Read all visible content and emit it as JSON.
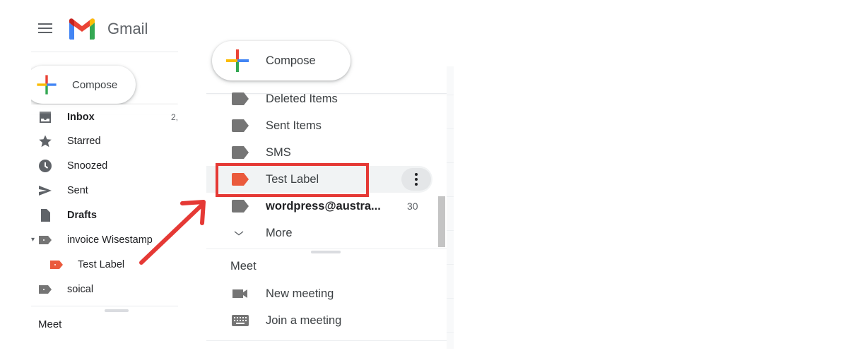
{
  "app": {
    "name": "Gmail"
  },
  "colors": {
    "accent_red": "#e53935",
    "label_gray": "#757575",
    "label_test": "#ea5a3c",
    "hover_bg": "#f1f3f4"
  },
  "left_panel": {
    "compose_label": "Compose",
    "items": [
      {
        "icon": "inbox-icon",
        "label": "Inbox",
        "count": "2,",
        "bold": true
      },
      {
        "icon": "star-icon",
        "label": "Starred"
      },
      {
        "icon": "clock-icon",
        "label": "Snoozed"
      },
      {
        "icon": "send-icon",
        "label": "Sent"
      },
      {
        "icon": "draft-icon",
        "label": "Drafts",
        "bold": true
      },
      {
        "icon": "label-icon",
        "label": "invoice Wisestamp",
        "expander": "▾"
      },
      {
        "icon": "label-icon",
        "label": "Test Label",
        "color": "#ea5a3c",
        "nested": true
      },
      {
        "icon": "label-icon",
        "label": "soical"
      }
    ],
    "meet_heading": "Meet"
  },
  "right_panel": {
    "compose_label": "Compose",
    "items": [
      {
        "icon": "label-icon",
        "label": "Deleted Items"
      },
      {
        "icon": "label-icon",
        "label": "Sent Items"
      },
      {
        "icon": "label-icon",
        "label": "SMS"
      },
      {
        "icon": "label-icon",
        "label": "Test Label",
        "color": "#ea5a3c",
        "hovered": true,
        "menu_icon": "more-vert-icon"
      },
      {
        "icon": "label-icon",
        "label": "wordpress@austra...",
        "count": "30",
        "bold": true
      },
      {
        "icon": "chevron-down-icon",
        "label": "More"
      }
    ],
    "meet": {
      "heading": "Meet",
      "items": [
        {
          "icon": "videocam-icon",
          "label": "New meeting"
        },
        {
          "icon": "keyboard-icon",
          "label": "Join a meeting"
        }
      ]
    }
  },
  "annotation": {
    "highlight_target": "Test Label",
    "arrow": "red-arrow"
  }
}
